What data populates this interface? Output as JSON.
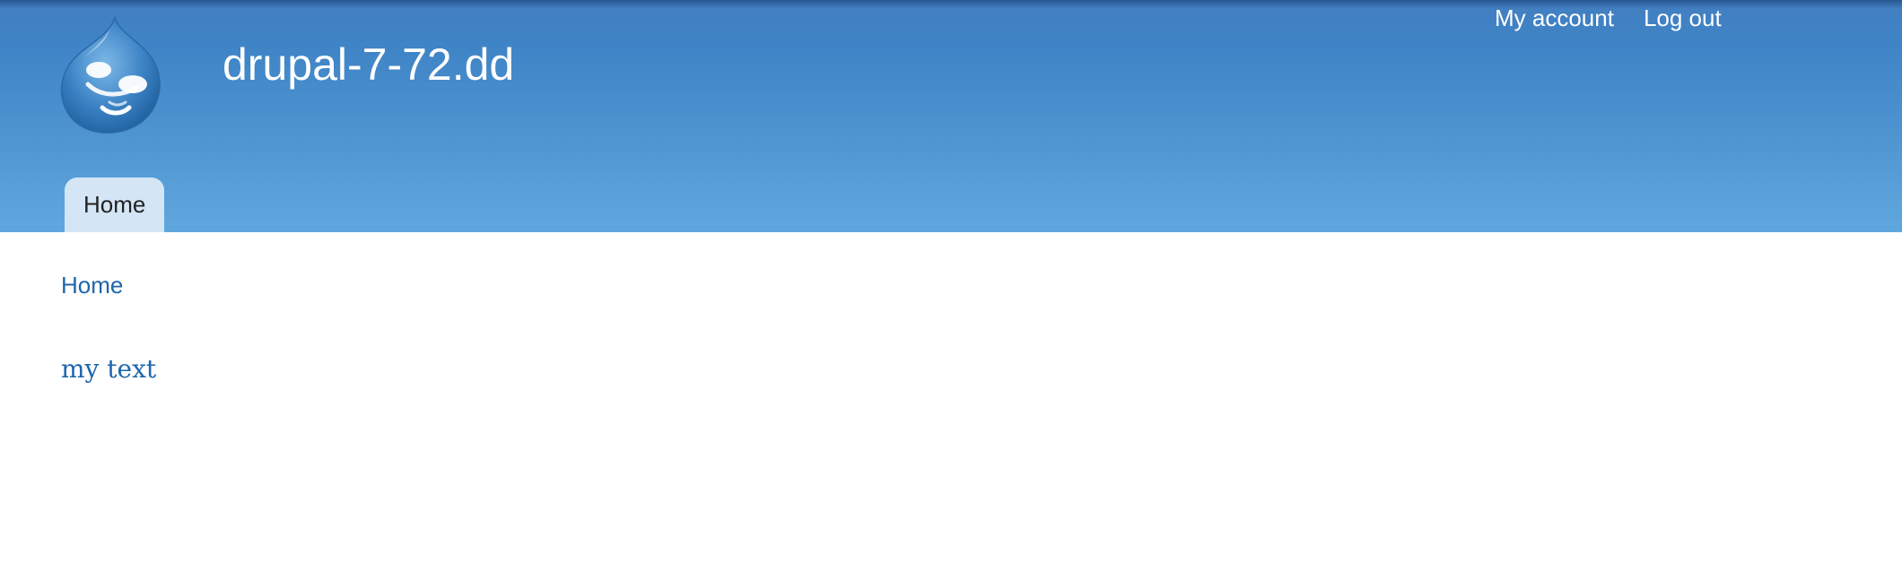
{
  "site": {
    "name": "drupal-7-72.dd",
    "logo_icon": "drupal-drop-logo-icon"
  },
  "secondary_menu": {
    "my_account": "My account",
    "log_out": "Log out"
  },
  "main_menu": {
    "items": [
      {
        "label": "Home",
        "active": true
      }
    ]
  },
  "breadcrumb": {
    "home": "Home"
  },
  "content": {
    "text": "my text"
  },
  "colors": {
    "header_top": "#3a7dc0",
    "header_bottom": "#5fa7de",
    "tab_background": "#d4e5f5",
    "link": "#1e66ab",
    "header_text": "#ffffff"
  }
}
